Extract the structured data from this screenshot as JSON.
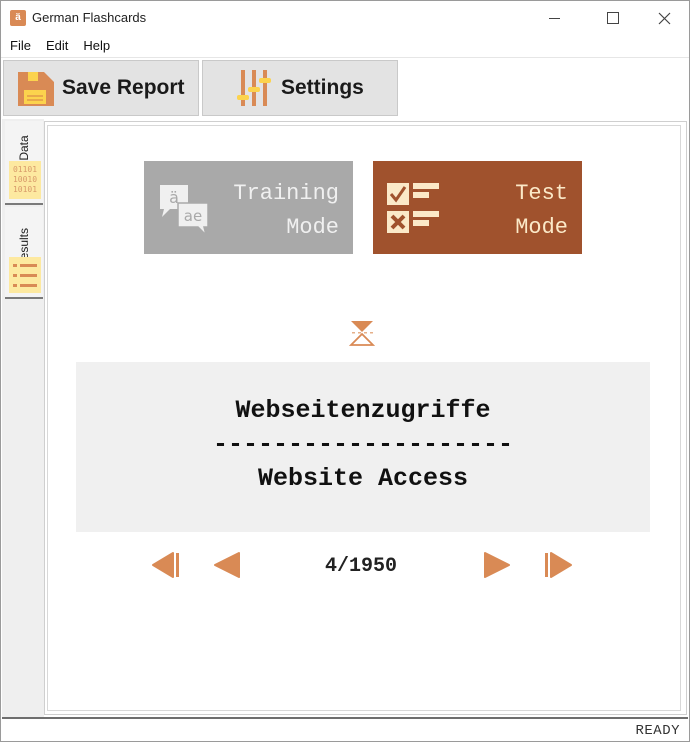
{
  "window": {
    "title": "German Flashcards",
    "app_icon_glyph": "ä",
    "controls": [
      "minimize",
      "maximize",
      "close"
    ]
  },
  "menu": {
    "items": [
      {
        "label": "File"
      },
      {
        "label": "Edit"
      },
      {
        "label": "Help"
      }
    ]
  },
  "toolbar": {
    "save_label": "Save Report",
    "save_icon": "floppy-disk-icon",
    "settings_label": "Settings",
    "settings_icon": "sliders-icon"
  },
  "side_tabs": [
    {
      "label": "Data",
      "icon": "binary-data-icon",
      "icon_text": [
        "01101",
        "10010",
        "10101"
      ]
    },
    {
      "label": "Results",
      "icon": "list-icon"
    }
  ],
  "modes": {
    "training": {
      "line1": "Training",
      "line2": "Mode",
      "icon": "speech-bubbles-icon",
      "icon_glyphs": [
        "ä",
        "ae"
      ],
      "active": false
    },
    "test": {
      "line1": "Test",
      "line2": "Mode",
      "icon": "checklist-icon",
      "active": true
    }
  },
  "timer_icon": "hourglass-icon",
  "card": {
    "german": "Webseitenzugriffe",
    "separator": "--------------------",
    "english": "Website Access"
  },
  "navigation": {
    "current": 4,
    "total": 1950,
    "counter_text": "4/1950"
  },
  "status": {
    "text": "READY"
  },
  "colors": {
    "accent": "#a0522d",
    "nav_accent": "#d98a55",
    "training_bg": "#a9a9a9",
    "card_bg": "#f0f0f0",
    "icon_highlight": "#fde9a0"
  }
}
